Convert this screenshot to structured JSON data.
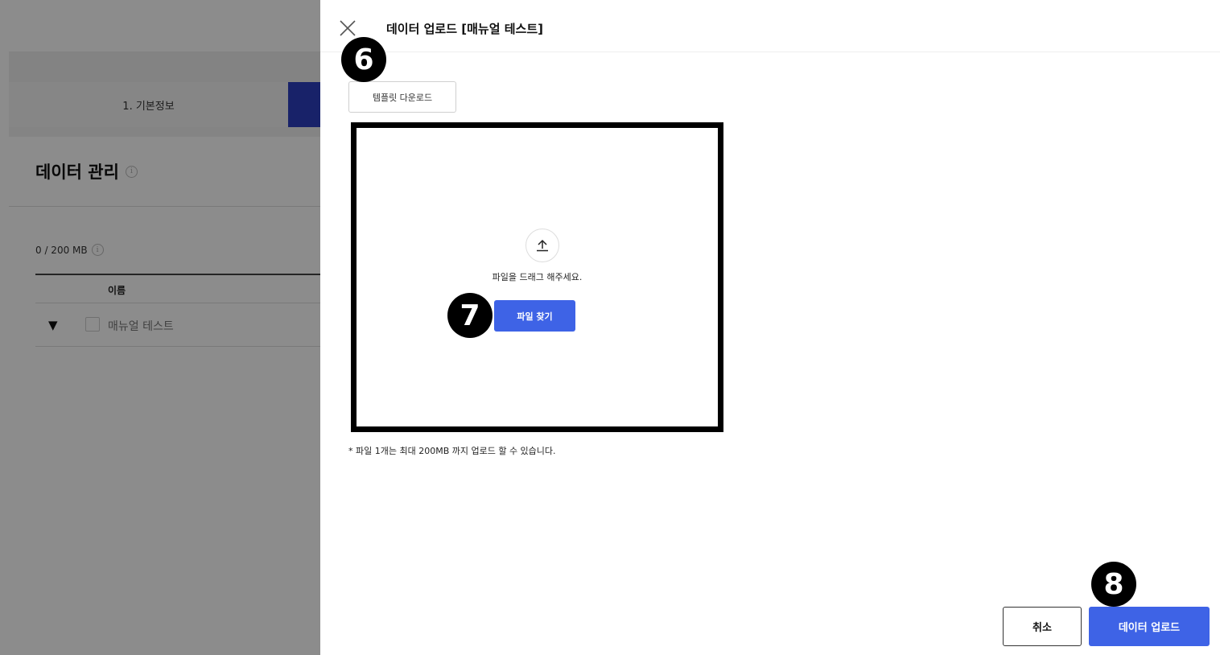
{
  "background": {
    "step_1_label": "1. 기본정보",
    "section_title": "데이터 관리",
    "info_glyph": "i",
    "storage_usage": "0 / 200 MB",
    "table": {
      "columns": [
        "이름"
      ],
      "rows": [
        {
          "expand_glyph": "▼",
          "name": "매뉴얼 테스트"
        }
      ]
    },
    "accent_color": "#2d3fbf"
  },
  "drawer": {
    "title": "데이터 업로드 [매뉴얼 테스트]",
    "template_download_label": "템플릿 다운로드",
    "dropzone": {
      "drag_text": "파일을 드래그 해주세요.",
      "find_file_label": "파일 찾기"
    },
    "note": "* 파일 1개는 최대 200MB 까지 업로드 할 수 있습니다.",
    "cancel_label": "취소",
    "upload_label": "데이터 업로드",
    "primary_color": "#3e63e6"
  },
  "markers": {
    "m6": "6",
    "m7": "7",
    "m8": "8"
  }
}
